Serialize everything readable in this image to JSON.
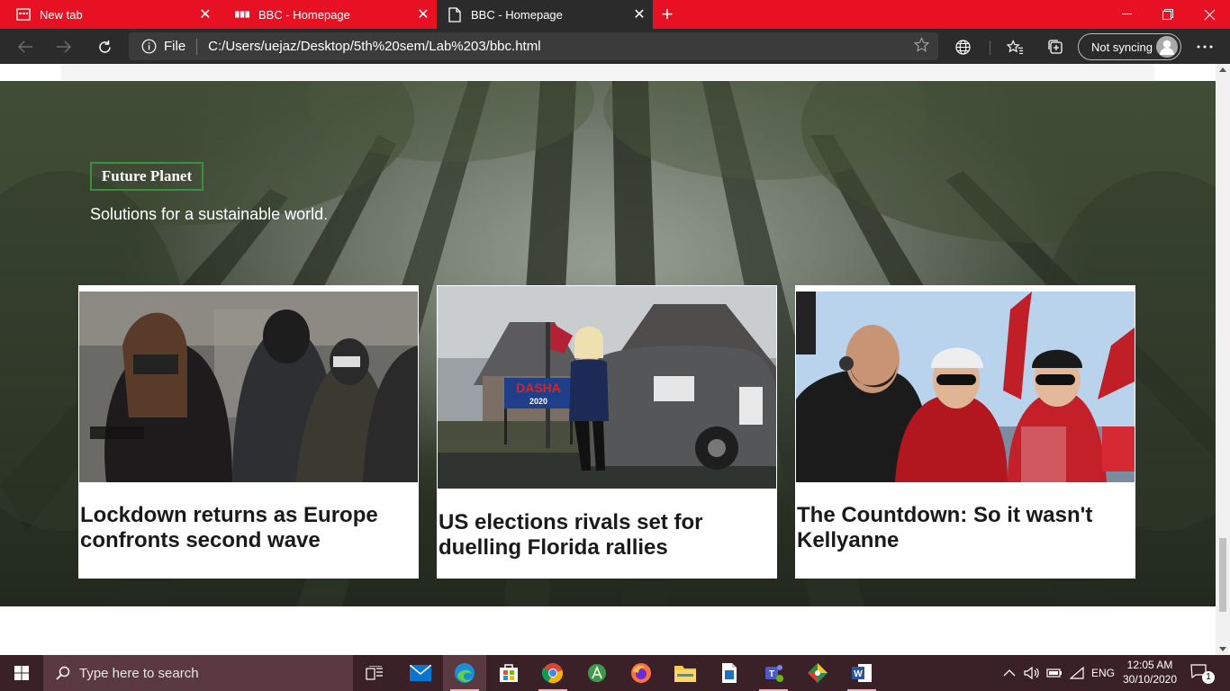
{
  "browser": {
    "tabs": [
      {
        "label": "New tab",
        "icon": "new-tab-page-icon"
      },
      {
        "label": "BBC - Homepage",
        "icon": "bbc-icon"
      },
      {
        "label": "BBC - Homepage",
        "icon": "page-icon"
      }
    ],
    "address": {
      "scheme_label": "File",
      "url": "C:/Users/uejaz/Desktop/5th%20sem/Lab%203/bbc.html"
    },
    "sync_label": "Not syncing",
    "colors": {
      "tabbar": "#e81123",
      "toolbar": "#2b2b2b"
    }
  },
  "section": {
    "badge": "Future Planet",
    "subtitle": "Solutions for a sustainable world.",
    "badge_border_color": "#3e8e41"
  },
  "cards": [
    {
      "headline": "Lockdown returns as Europe confronts second wave"
    },
    {
      "headline": "US elections rivals set for duelling Florida rallies",
      "sign_text": "DASHA",
      "sign_year": "2020"
    },
    {
      "headline": "The Countdown: So it wasn't Kellyanne"
    }
  ],
  "taskbar": {
    "search_placeholder": "Type here to search",
    "language": "ENG",
    "time": "12:05 AM",
    "date": "30/10/2020",
    "notification_count": "1"
  }
}
